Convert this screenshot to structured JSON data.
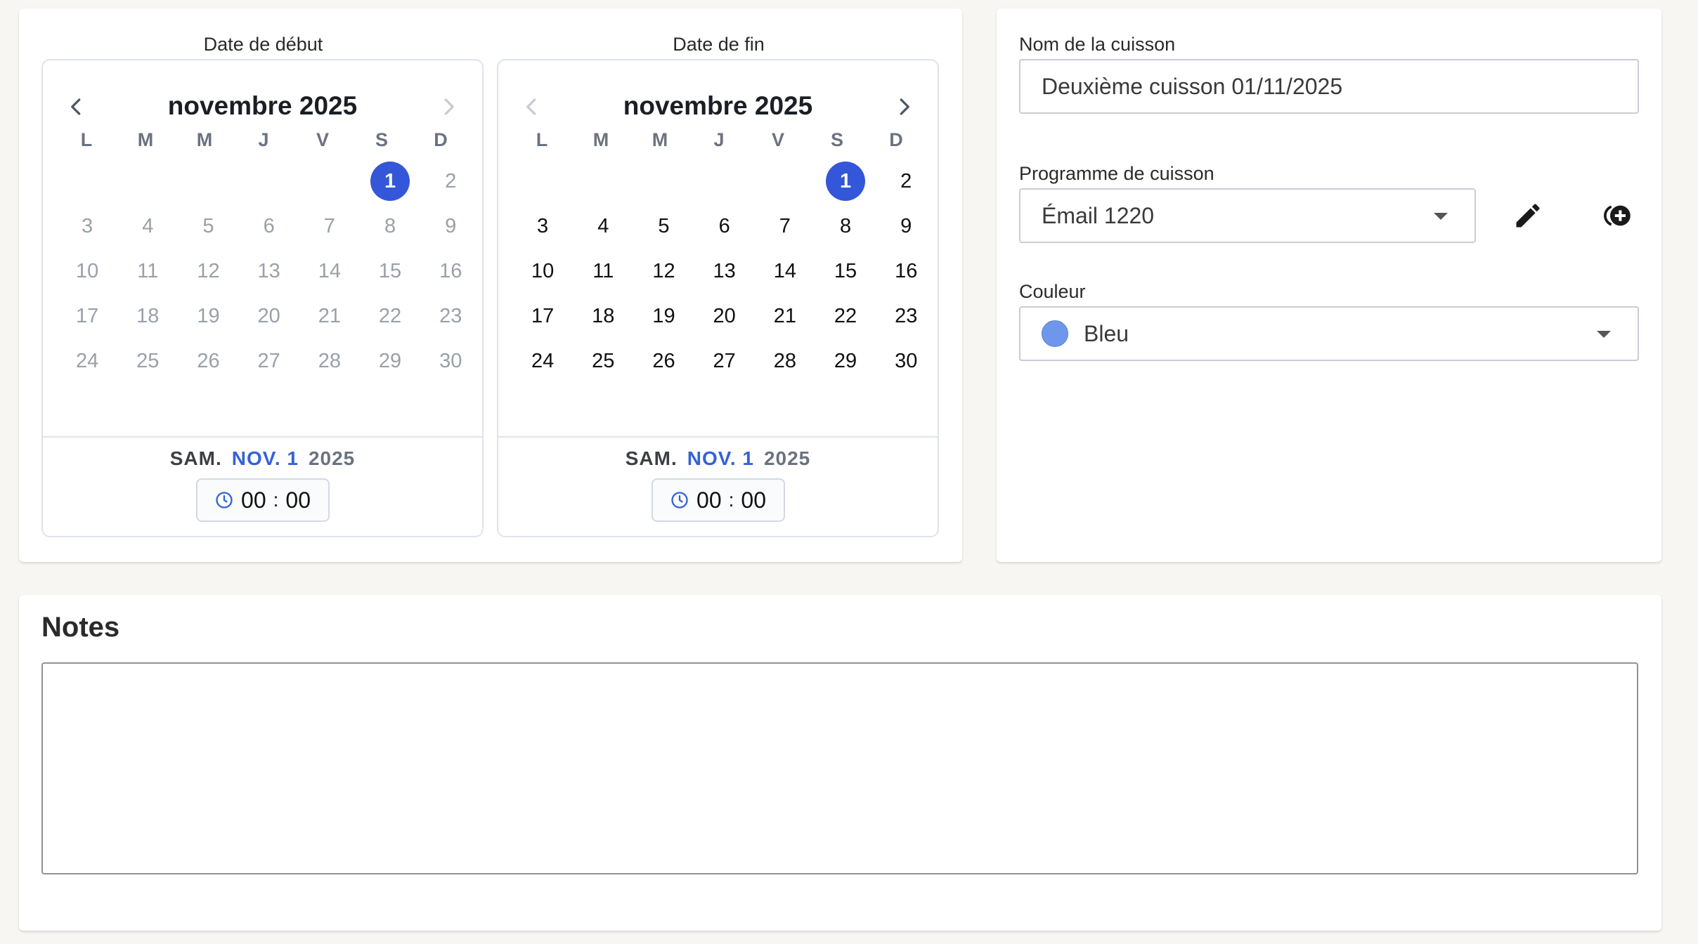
{
  "start_date": {
    "label": "Date de début",
    "month_title": "novembre 2025",
    "weekdays": [
      "L",
      "M",
      "M",
      "J",
      "V",
      "S",
      "D"
    ],
    "footer_weekday": "SAM.",
    "footer_monthday": "NOV. 1",
    "footer_year": "2025",
    "hours": "00",
    "colon": ":",
    "minutes": "00"
  },
  "end_date": {
    "label": "Date de fin",
    "month_title": "novembre 2025",
    "weekdays": [
      "L",
      "M",
      "M",
      "J",
      "V",
      "S",
      "D"
    ],
    "footer_weekday": "SAM.",
    "footer_monthday": "NOV. 1",
    "footer_year": "2025",
    "hours": "00",
    "colon": ":",
    "minutes": "00"
  },
  "calendar_days": [
    "1",
    "2",
    "3",
    "4",
    "5",
    "6",
    "7",
    "8",
    "9",
    "10",
    "11",
    "12",
    "13",
    "14",
    "15",
    "16",
    "17",
    "18",
    "19",
    "20",
    "21",
    "22",
    "23",
    "24",
    "25",
    "26",
    "27",
    "28",
    "29",
    "30"
  ],
  "calendar_first_weekday_index": 5,
  "selected_day": "1",
  "form": {
    "name_label": "Nom de la cuisson",
    "name_value": "Deuxième cuisson 01/11/2025",
    "program_label": "Programme de cuisson",
    "program_value": "Émail 1220",
    "color_label": "Couleur",
    "color_value": "Bleu",
    "color_hex": "#6e96ea"
  },
  "notes": {
    "title": "Notes",
    "value": ""
  },
  "icons": {
    "prev": "chevron-left-icon",
    "next": "chevron-right-icon",
    "clock": "clock-icon",
    "edit": "pencil-icon",
    "add": "add-circle-icon"
  },
  "colors": {
    "accent": "#3357d8",
    "accent_text": "#3463d6"
  }
}
